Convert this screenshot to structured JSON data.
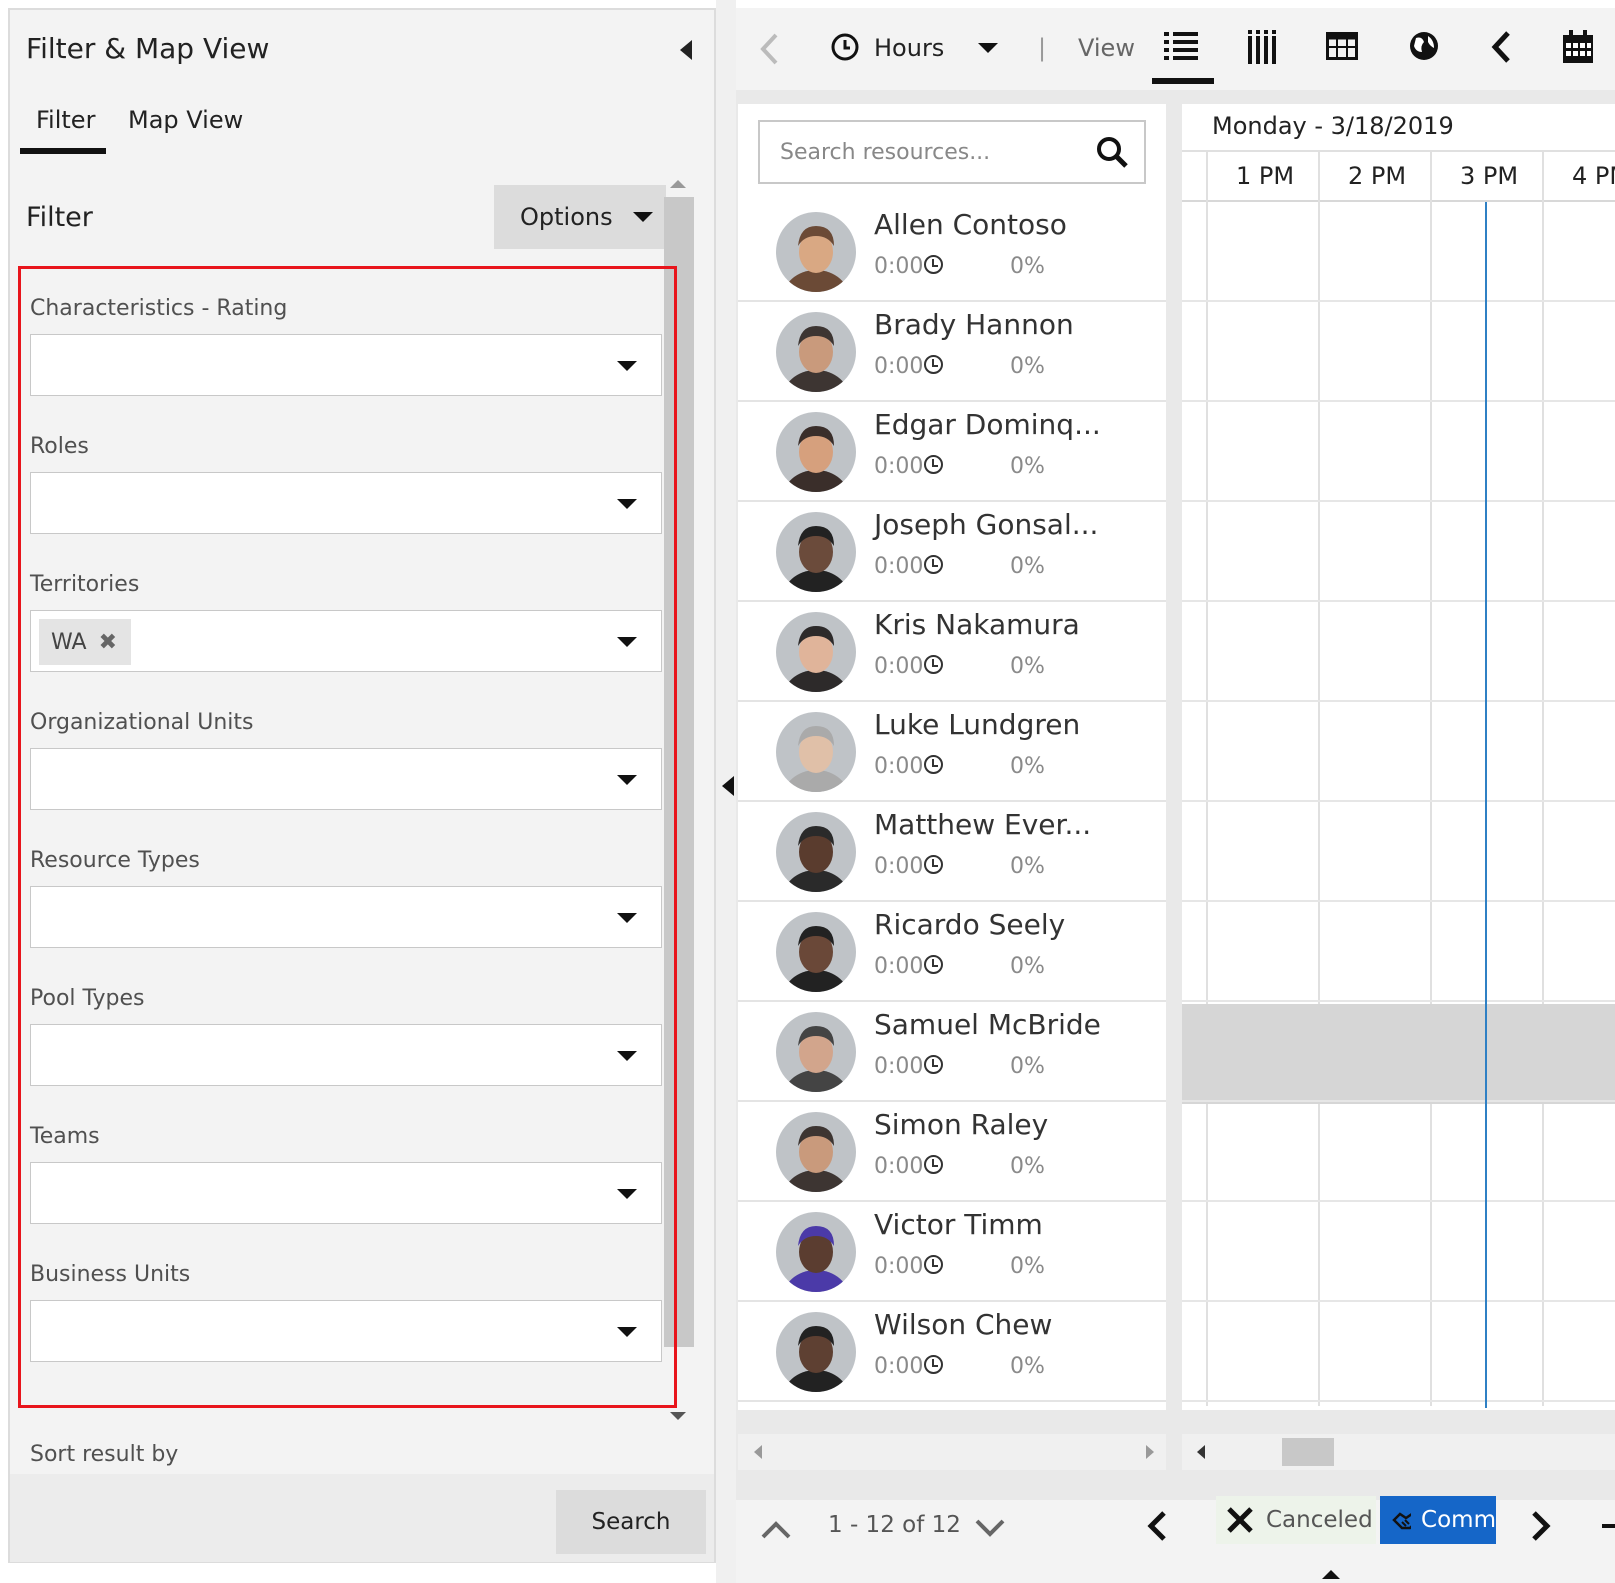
{
  "left_panel": {
    "title": "Filter & Map View",
    "tabs": [
      "Filter",
      "Map View"
    ],
    "filter_heading": "Filter",
    "options_label": "Options",
    "fields": [
      {
        "label": "Characteristics - Rating",
        "chips": []
      },
      {
        "label": "Roles",
        "chips": []
      },
      {
        "label": "Territories",
        "chips": [
          "WA"
        ]
      },
      {
        "label": "Organizational Units",
        "chips": []
      },
      {
        "label": "Resource Types",
        "chips": []
      },
      {
        "label": "Pool Types",
        "chips": []
      },
      {
        "label": "Teams",
        "chips": []
      },
      {
        "label": "Business Units",
        "chips": []
      }
    ],
    "sort_label": "Sort result by",
    "search_button": "Search"
  },
  "toolbar": {
    "hours_label": "Hours",
    "separator": "|",
    "view_label": "View"
  },
  "resources": {
    "search_placeholder": "Search resources...",
    "items": [
      {
        "name": "Allen Contoso",
        "hours": "0:00",
        "pct": "0%"
      },
      {
        "name": "Brady Hannon",
        "hours": "0:00",
        "pct": "0%"
      },
      {
        "name": "Edgar Dominq...",
        "hours": "0:00",
        "pct": "0%"
      },
      {
        "name": "Joseph Gonsal...",
        "hours": "0:00",
        "pct": "0%"
      },
      {
        "name": "Kris Nakamura",
        "hours": "0:00",
        "pct": "0%"
      },
      {
        "name": "Luke Lundgren",
        "hours": "0:00",
        "pct": "0%"
      },
      {
        "name": "Matthew Ever...",
        "hours": "0:00",
        "pct": "0%"
      },
      {
        "name": "Ricardo Seely",
        "hours": "0:00",
        "pct": "0%"
      },
      {
        "name": "Samuel McBride",
        "hours": "0:00",
        "pct": "0%"
      },
      {
        "name": "Simon Raley",
        "hours": "0:00",
        "pct": "0%"
      },
      {
        "name": "Victor Timm",
        "hours": "0:00",
        "pct": "0%"
      },
      {
        "name": "Wilson Chew",
        "hours": "0:00",
        "pct": "0%"
      }
    ]
  },
  "timeline": {
    "date": "Monday - 3/18/2019",
    "hours": [
      "1 PM",
      "2 PM",
      "3 PM",
      "4 PM"
    ]
  },
  "footer": {
    "pager": "1 - 12 of 12",
    "legend_canceled": "Canceled",
    "legend_comm": "Comm"
  },
  "colors": {
    "accent_blue": "#1566c8",
    "now_line": "#2f80c4",
    "highlight_red": "#e8141b"
  }
}
